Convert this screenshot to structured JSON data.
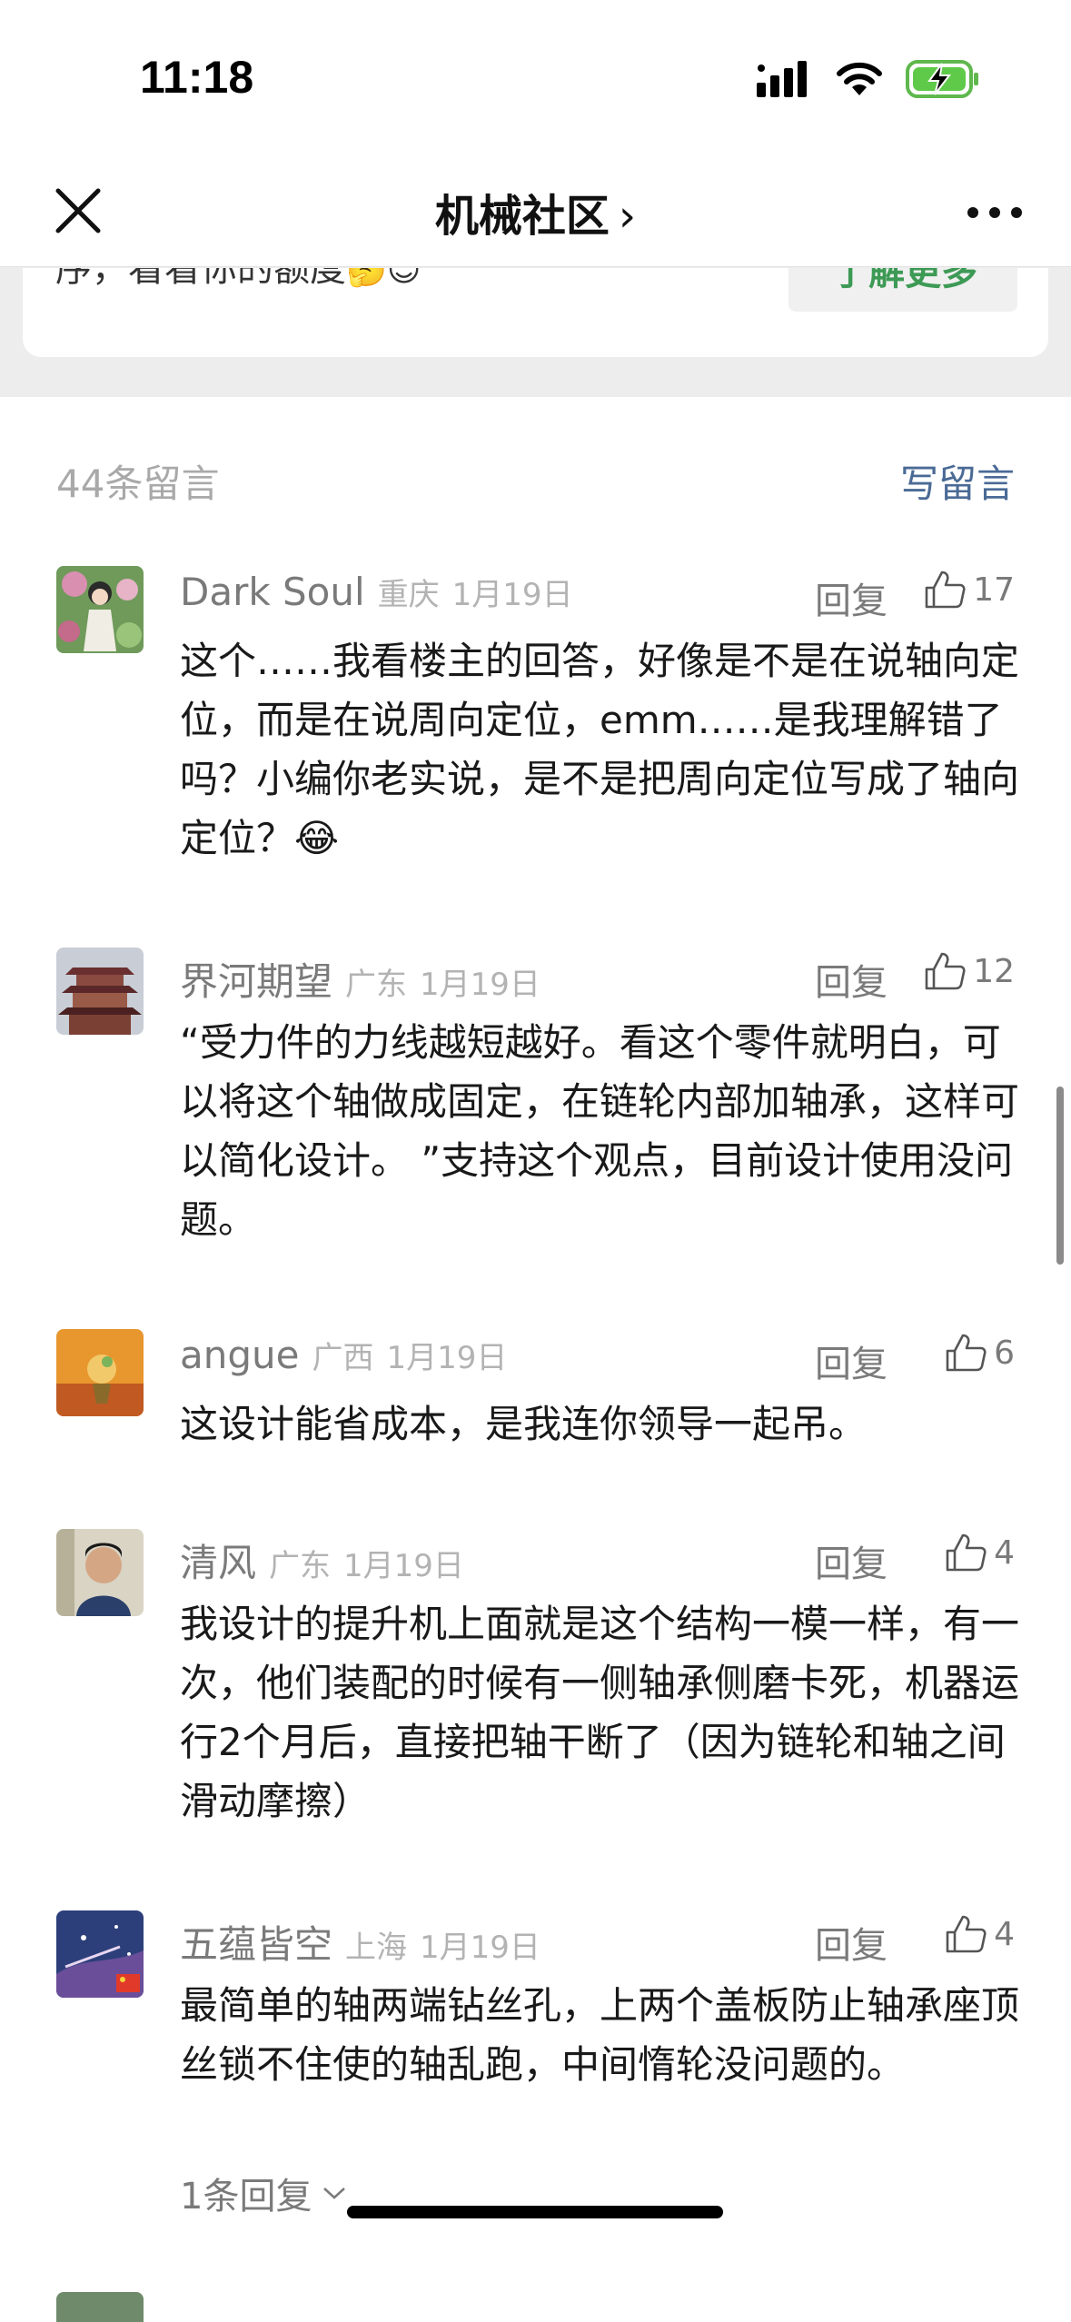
{
  "status_bar": {
    "time": "11:18"
  },
  "nav": {
    "title": "机械社区",
    "chevron": "›"
  },
  "card": {
    "text": "序，看看你的额度",
    "emojis": "🤔😊",
    "button_label": "了解更多"
  },
  "comments_header": {
    "count_label": "44条留言",
    "write_label": "写留言"
  },
  "comments": [
    {
      "name": "Dark Soul",
      "region": "重庆",
      "date": "1月19日",
      "reply": "回复",
      "likes": "17",
      "text": "这个……我看楼主的回答，好像是不是在说轴向定位，而是在说周向定位，emm……是我理解错了吗？小编你老实说，是不是把周向定位写成了轴向定位？😂"
    },
    {
      "name": "界河期望",
      "region": "广东",
      "date": "1月19日",
      "reply": "回复",
      "likes": "12",
      "text": "“受力件的力线越短越好。看这个零件就明白，可以将这个轴做成固定，在链轮内部加轴承，这样可以简化设计。 ”支持这个观点，目前设计使用没问题。"
    },
    {
      "name": "angue",
      "region": "广西",
      "date": "1月19日",
      "reply": "回复",
      "likes": "6",
      "text": "这设计能省成本，是我连你领导一起吊。"
    },
    {
      "name": "清风",
      "region": "广东",
      "date": "1月19日",
      "reply": "回复",
      "likes": "4",
      "text": "我设计的提升机上面就是这个结构一模一样，有一次，他们装配的时候有一侧轴承侧磨卡死，机器运行2个月后，直接把轴干断了（因为链轮和轴之间滑动摩擦）"
    },
    {
      "name": "五蕴皆空",
      "region": "上海",
      "date": "1月19日",
      "reply": "回复",
      "likes": "4",
      "text": "最简单的轴两端钻丝孔，上两个盖板防止轴承座顶丝锁不住使的轴乱跑，中间惰轮没问题的。",
      "sub_replies": "1条回复"
    }
  ],
  "colors": {
    "accent_green": "#3d9a55",
    "link_blue": "#4a6a96",
    "meta_gray": "#7a7a7a"
  }
}
